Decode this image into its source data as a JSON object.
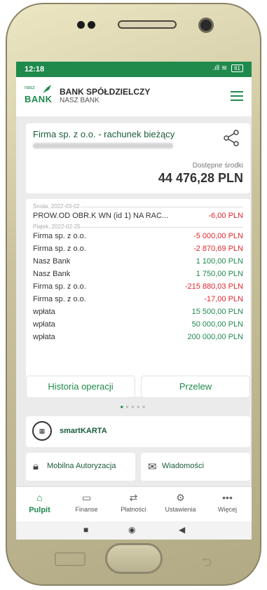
{
  "status_bar": {
    "time": "12:18",
    "signal": ".ıll",
    "wifi": "≋",
    "battery": "61"
  },
  "header": {
    "logo_small": "nasz",
    "logo_main": "BANK",
    "bank_name": "BANK SPÓŁDZIELCZY",
    "bank_sub": "NASZ BANK",
    "menu_icon": "hamburger-menu-icon"
  },
  "account": {
    "name": "Firma sp. z o.o. - rachunek bieżący",
    "available_label": "Dostępne środki",
    "available_amount": "44 476,28 PLN",
    "share_icon": "share-icon"
  },
  "transactions": {
    "date_1": "Środa, 2022-03-02",
    "date_2": "Piątek, 2022-02-25",
    "rows": [
      {
        "desc": "PROW.OD OBR.K WN (id 1) NA RAC...",
        "amount": "-6,00 PLN",
        "sign": "neg"
      },
      {
        "desc": "Firma sp. z o.o.",
        "amount": "-5 000,00 PLN",
        "sign": "neg"
      },
      {
        "desc": "Firma sp. z o.o.",
        "amount": "-2 870,69 PLN",
        "sign": "neg"
      },
      {
        "desc": "Nasz Bank",
        "amount": "1 100,00 PLN",
        "sign": "pos"
      },
      {
        "desc": "Nasz Bank",
        "amount": "1 750,00 PLN",
        "sign": "pos"
      },
      {
        "desc": "Firma sp. z o.o.",
        "amount": "-215 880,03 PLN",
        "sign": "neg"
      },
      {
        "desc": "Firma sp. z o.o.",
        "amount": "-17,00 PLN",
        "sign": "neg"
      },
      {
        "desc": "wpłata",
        "amount": "15 500,00 PLN",
        "sign": "pos"
      },
      {
        "desc": "wpłata",
        "amount": "50 000,00 PLN",
        "sign": "pos"
      },
      {
        "desc": "wpłata",
        "amount": "200 000,00 PLN",
        "sign": "pos"
      }
    ]
  },
  "actions": {
    "history": "Historia operacji",
    "transfer": "Przelew"
  },
  "pager": {
    "count": 5,
    "active": 0
  },
  "smart": {
    "label": "smartKARTA",
    "icon": "qr-code-icon"
  },
  "tiles": {
    "auth": "Mobilna Autoryzacja",
    "messages": "Wiadomości"
  },
  "nav": {
    "items": [
      {
        "label": "Pulpit",
        "icon": "home-icon",
        "active": true
      },
      {
        "label": "Finanse",
        "icon": "wallet-icon",
        "active": false
      },
      {
        "label": "Płatności",
        "icon": "transfer-arrows-icon",
        "active": false
      },
      {
        "label": "Ustawienia",
        "icon": "gear-icon",
        "active": false
      },
      {
        "label": "Więcej",
        "icon": "more-dots-icon",
        "active": false
      }
    ]
  },
  "colors": {
    "brand": "#1f8a4c",
    "negative": "#e3262f"
  }
}
